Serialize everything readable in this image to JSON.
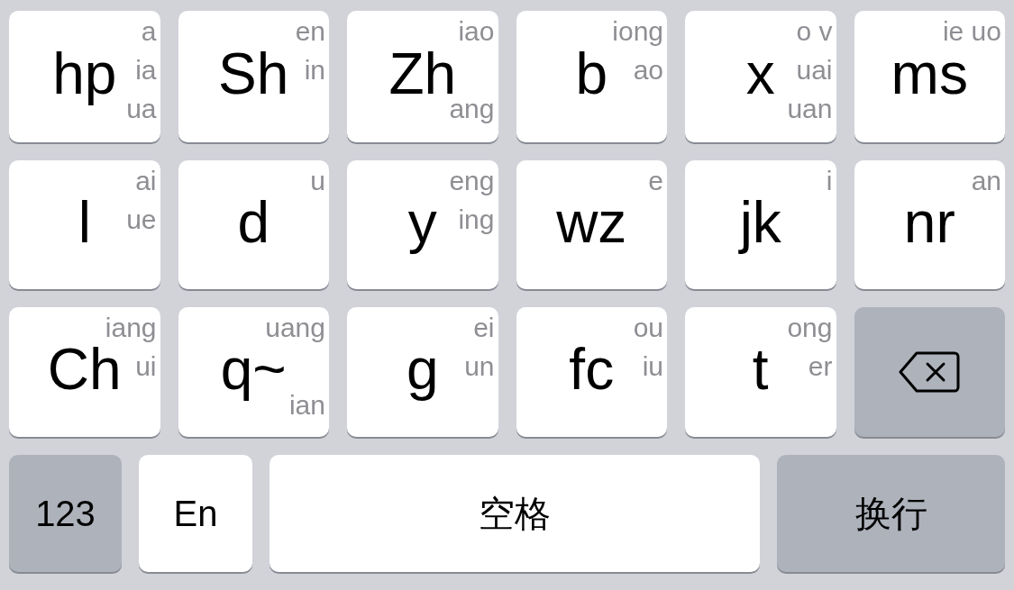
{
  "rows": [
    [
      {
        "kind": "letter",
        "label": "hp",
        "hints": {
          "top": "a",
          "middle": "ia",
          "bottom": "ua"
        }
      },
      {
        "kind": "letter",
        "label": "Sh",
        "hints": {
          "top": "en",
          "middle": "in"
        }
      },
      {
        "kind": "letter",
        "label": "Zh",
        "hints": {
          "top": "iao",
          "bottom": "ang"
        }
      },
      {
        "kind": "letter",
        "label": "b",
        "hints": {
          "top": "iong",
          "middle": "ao"
        }
      },
      {
        "kind": "letter",
        "label": "x",
        "hints": {
          "top": "o v",
          "middle": "uai",
          "bottom": "uan"
        }
      },
      {
        "kind": "letter",
        "label": "ms",
        "hints": {
          "top": "ie uo"
        }
      }
    ],
    [
      {
        "kind": "letter",
        "label": "l",
        "hints": {
          "top": "ai",
          "middle": "ue"
        }
      },
      {
        "kind": "letter",
        "label": "d",
        "hints": {
          "top": "u"
        }
      },
      {
        "kind": "letter",
        "label": "y",
        "hints": {
          "top": "eng",
          "middle": "ing"
        }
      },
      {
        "kind": "letter",
        "label": "wz",
        "hints": {
          "top": "e"
        }
      },
      {
        "kind": "letter",
        "label": "jk",
        "hints": {
          "top": "i"
        }
      },
      {
        "kind": "letter",
        "label": "nr",
        "hints": {
          "top": "an"
        }
      }
    ],
    [
      {
        "kind": "letter",
        "label": "Ch",
        "hints": {
          "top": "iang",
          "middle": "ui"
        }
      },
      {
        "kind": "letter",
        "label": "q~",
        "hints": {
          "top": "uang",
          "bottom": "ian"
        }
      },
      {
        "kind": "letter",
        "label": "g",
        "hints": {
          "top": "ei",
          "middle": "un"
        }
      },
      {
        "kind": "letter",
        "label": "fc",
        "hints": {
          "top": "ou",
          "middle": "iu"
        }
      },
      {
        "kind": "letter",
        "label": "t",
        "hints": {
          "top": "ong",
          "middle": "er"
        }
      },
      {
        "kind": "delete"
      }
    ]
  ],
  "bottom_row": [
    {
      "kind": "system",
      "label": "123"
    },
    {
      "kind": "plain",
      "label": "En"
    },
    {
      "kind": "plain",
      "label": "空格"
    },
    {
      "kind": "system",
      "label": "换行"
    }
  ]
}
